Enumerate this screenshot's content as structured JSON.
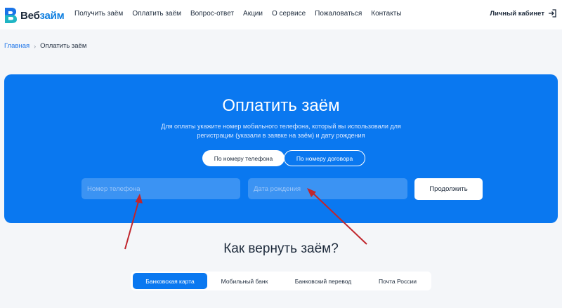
{
  "brand": {
    "name_prefix": "Веб",
    "name_suffix": "займ",
    "accent": "#0a78f0",
    "icon": "brand-logo-icon"
  },
  "nav": {
    "items": [
      {
        "label": "Получить заём"
      },
      {
        "label": "Оплатить заём"
      },
      {
        "label": "Вопрос-ответ"
      },
      {
        "label": "Акции"
      },
      {
        "label": "О сервисе"
      },
      {
        "label": "Пожаловаться"
      },
      {
        "label": "Контакты"
      }
    ],
    "cabinet_label": "Личный кабинет",
    "cabinet_icon": "login-icon"
  },
  "breadcrumb": {
    "home": "Главная",
    "separator": "›",
    "current": "Оплатить заём"
  },
  "hero": {
    "title": "Оплатить заём",
    "description": "Для оплаты укажите номер мобильного телефона, который вы использовали для регистрации (указали в заявке на заём) и дату рождения",
    "tabs": [
      {
        "label": "По номеру телефона",
        "active": true
      },
      {
        "label": "По номеру договора",
        "active": false
      }
    ],
    "phone_placeholder": "Номер телефона",
    "date_placeholder": "Дата рождения",
    "submit_label": "Продолжить"
  },
  "repay": {
    "title": "Как вернуть заём?",
    "methods": [
      {
        "label": "Банковская карта",
        "active": true
      },
      {
        "label": "Мобильный банк",
        "active": false
      },
      {
        "label": "Банковский перевод",
        "active": false
      },
      {
        "label": "Почта России",
        "active": false
      }
    ]
  },
  "annotation": {
    "arrow_color": "#c0262d"
  }
}
